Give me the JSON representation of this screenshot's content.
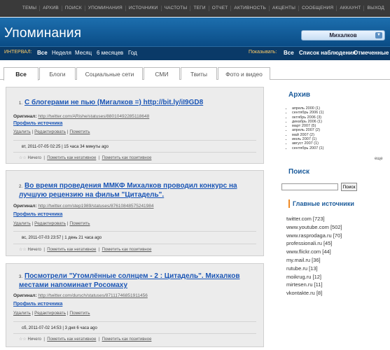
{
  "topnav": {
    "items": [
      "ТЕМЫ",
      "АРХИВ",
      "ПОИСК",
      "УПОМИНАНИЯ",
      "ИСТОЧНИКИ",
      "ЧАСТОТЫ",
      "ТЕГИ",
      "ОТЧЕТ",
      "АКТИВНОСТЬ",
      "АКЦЕНТЫ",
      "СООБЩЕНИЯ",
      "АККАУНТ",
      "ВЫХОД"
    ]
  },
  "header": {
    "title": "Упоминания",
    "subject": "Михалков"
  },
  "filter": {
    "interval_label": "ИНТЕРВАЛ:",
    "intervals": [
      "Все",
      "Неделя",
      "Месяц",
      "6 месяцев",
      "Год"
    ],
    "show_label": "Показывать:",
    "show_options": [
      "Все",
      "Список наблюдения",
      "Отмеченные"
    ]
  },
  "tabs": [
    "Все",
    "Блоги",
    "Социальные сети",
    "СМИ",
    "Твиты",
    "Фото и видео"
  ],
  "mentions": [
    {
      "num": "1.",
      "title": "С блогерами не пью (Мигалков =) http://bit.ly/iI9GD8",
      "original_label": "Оригинал:",
      "original_url": "http://twitter.com/ARishe/statuses/88010492285118648",
      "profile": "Профиль источника",
      "delete": "Удалить",
      "edit": "Редактировать",
      "mark": "Пометить",
      "date": "вт, 2011-07-05 02:25 | 15 часа 34 минуты ago",
      "rate_label": "Ничего",
      "negative": "Пометить как негативное",
      "positive": "Пометить как позитивное"
    },
    {
      "num": "2.",
      "title": "Во время проведения ММКФ Михалков проводил конкурс на лучшую рецензию на фильм \"Цитадель\".",
      "original_label": "Оригинал:",
      "original_url": "http://twitter.com/step1989/statuses/87610848575241984",
      "profile": "Профиль источника",
      "delete": "Удалить",
      "edit": "Редактировать",
      "mark": "Пометить",
      "date": "вс, 2011-07-03 23:57 | 1 день 21 часа ago",
      "rate_label": "Ничего",
      "negative": "Пометить как негативное",
      "positive": "Пометить как позитивное"
    },
    {
      "num": "3.",
      "title": "Посмотрели \"Утомлённые солнцем - 2 : Цитадель\". Михалков местами напоминает Росомаху",
      "original_label": "Оригинал:",
      "original_url": "http://twitter.com/dursch/statuses/87111746851911456",
      "profile": "Профиль источника",
      "delete": "Удалить",
      "edit": "Редактировать",
      "mark": "Пометить",
      "date": "сб, 2011-07-02 14:53 | 3 дня 6 часа ago",
      "rate_label": "Ничего",
      "negative": "Пометить как негативное",
      "positive": "Пометить как позитивное"
    }
  ],
  "sidebar": {
    "archive_title": "Архив",
    "archive": [
      "апрель 2000 (1)",
      "сентябрь 2006 (1)",
      "октябрь 2006 (3)",
      "декабрь 2006 (1)",
      "март 2007 (5)",
      "апрель 2007 (2)",
      "май 2007 (2)",
      "июль 2007 (1)",
      "август 2007 (1)",
      "сентябрь 2007 (1)"
    ],
    "more": "еще",
    "search_title": "Поиск",
    "search_button": "Поиск",
    "sources_title": "Главные источники",
    "sources": [
      "twitter.com [723]",
      "www.youtube.com [502]",
      "www.rasprodaga.ru [70]",
      "professionali.ru [45]",
      "www.flickr.com [44]",
      "my.mail.ru [36]",
      "rutube.ru [13]",
      "moikrug.ru [12]",
      "mirtesen.ru [11]",
      "vkontakte.ru [8]"
    ]
  }
}
